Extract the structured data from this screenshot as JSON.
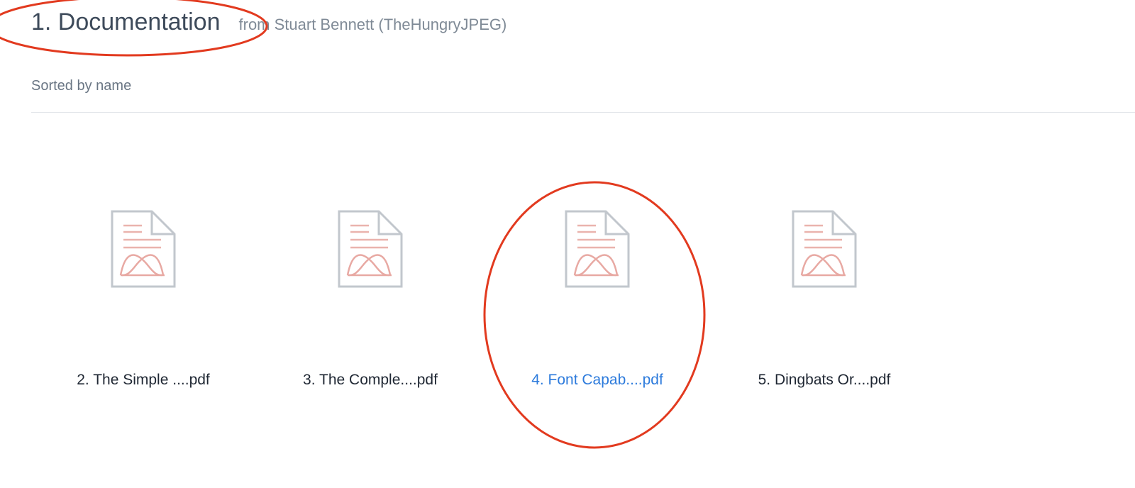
{
  "folder": {
    "title": "1. Documentation",
    "shared_from": "from Stuart Bennett (TheHungryJPEG)"
  },
  "sort": {
    "label": "Sorted by name"
  },
  "files": [
    {
      "name": "2. The Simple ....pdf",
      "icon": "pdf-file-icon",
      "selected": false
    },
    {
      "name": "3. The Comple....pdf",
      "icon": "pdf-file-icon",
      "selected": false
    },
    {
      "name": "4. Font Capab....pdf",
      "icon": "pdf-file-icon",
      "selected": true
    },
    {
      "name": "5. Dingbats Or....pdf",
      "icon": "pdf-file-icon",
      "selected": false
    }
  ],
  "colors": {
    "title": "#3d4a5a",
    "muted": "#7f8a96",
    "selected_link": "#2d7bdc",
    "annotation": "#e23a1f",
    "icon_outline": "#c2c7cd",
    "icon_accent": "#e8a9a3"
  }
}
